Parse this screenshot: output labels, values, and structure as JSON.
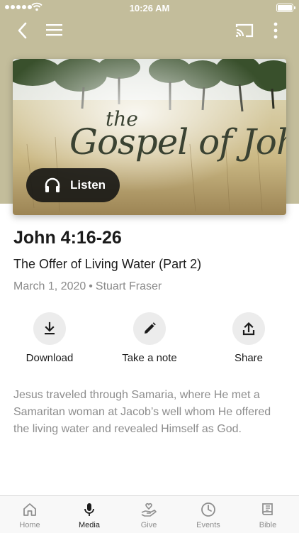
{
  "status_bar": {
    "time": "10:26 AM"
  },
  "artwork": {
    "title_small": "the",
    "title_main": "Gospel of John",
    "listen_label": "Listen"
  },
  "sermon": {
    "reference": "John 4:16-26",
    "title": "The Offer of Living Water (Part 2)",
    "date": "March 1, 2020",
    "separator": "•",
    "speaker": "Stuart Fraser",
    "description": "Jesus traveled through Samaria, where He met a Samaritan woman at Jacob’s well whom He offered the living water and revealed Himself as God."
  },
  "actions": [
    {
      "label": "Download",
      "icon": "download-icon"
    },
    {
      "label": "Take a note",
      "icon": "pencil-icon"
    },
    {
      "label": "Share",
      "icon": "share-icon"
    }
  ],
  "tabs": [
    {
      "label": "Home",
      "icon": "home-icon",
      "active": false
    },
    {
      "label": "Media",
      "icon": "microphone-icon",
      "active": true
    },
    {
      "label": "Give",
      "icon": "give-icon",
      "active": false
    },
    {
      "label": "Events",
      "icon": "clock-icon",
      "active": false
    },
    {
      "label": "Bible",
      "icon": "bible-icon",
      "active": false
    }
  ],
  "colors": {
    "header_background": "#c3bd9b",
    "secondary_text": "#8a8a8a",
    "action_circle": "#ececec",
    "tab_active": "#1c1c1c",
    "tab_inactive": "#8e8e8e"
  }
}
